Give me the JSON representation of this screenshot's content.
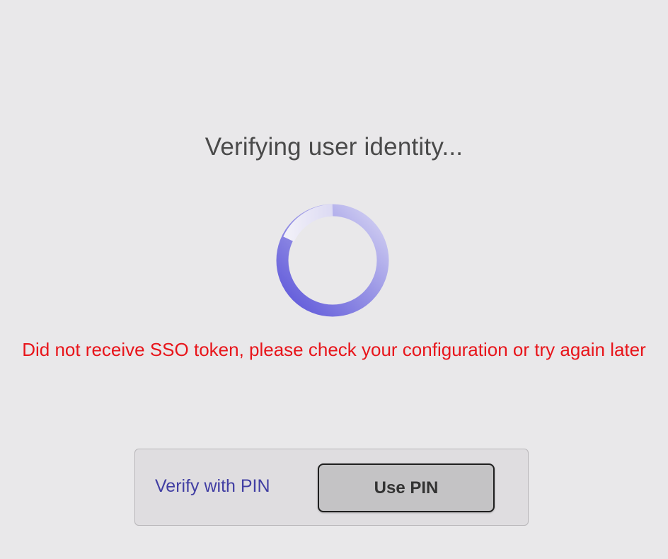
{
  "status": {
    "title": "Verifying user identity..."
  },
  "spinner": {
    "icon": "loading-spinner-icon",
    "colors": [
      "#5b54d9",
      "#aaa6e8",
      "#efeef7"
    ]
  },
  "error": {
    "message": "Did not receive SSO token, please check your configuration or try again later",
    "color": "#e8151b"
  },
  "pin": {
    "label": "Verify with PIN",
    "button_label": "Use PIN"
  },
  "theme": {
    "background": "#e9e8ea",
    "accent": "#413ea3"
  }
}
